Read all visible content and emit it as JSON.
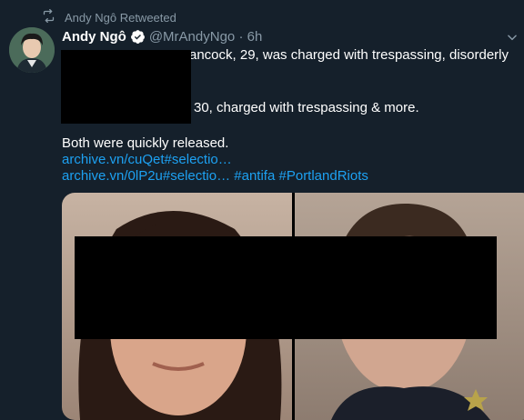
{
  "retweet": {
    "label": "Andy Ngô Retweeted",
    "icon": "retweet-icon"
  },
  "tweet": {
    "author_name": "Andy Ngô",
    "handle": "@MrAndyNgo",
    "separator": "·",
    "time": "6h",
    "verified": true,
    "line1": "ancock, 29, was charged with trespassing, disorderly",
    "line2": "30, charged with trespassing & more.",
    "line3": "Both were quickly released.",
    "link1": "archive.vn/cuQet#selectio…",
    "link2": "archive.vn/0lP2u#selectio…",
    "hashtag1": "#antifa",
    "hashtag2": "#PortlandRiots"
  },
  "colors": {
    "background": "#15202b",
    "secondary_text": "#8899a6",
    "link": "#1da1f2",
    "verified_badge": "#1da1f2",
    "redaction": "#000000"
  }
}
